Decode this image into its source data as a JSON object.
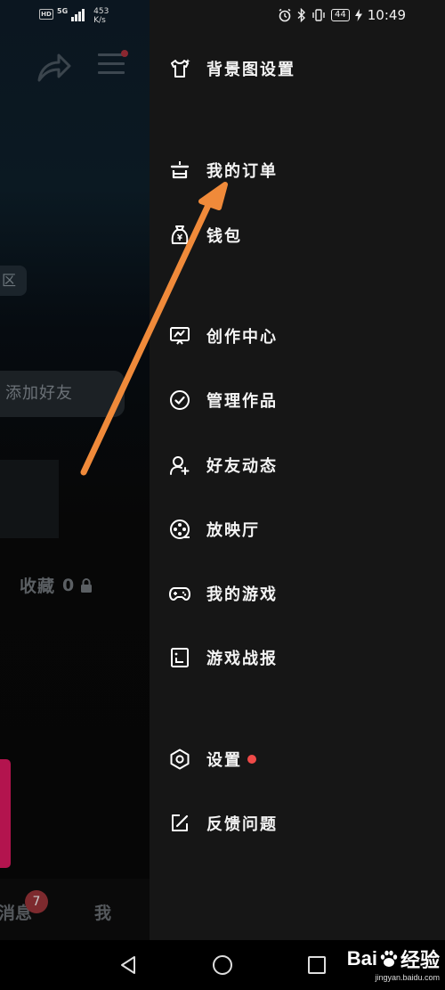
{
  "status_bar": {
    "hd": "HD",
    "network": "5G",
    "speed_value": "453",
    "speed_unit": "K/s",
    "battery": "44",
    "time": "10:49"
  },
  "background_page": {
    "region_text": "区",
    "add_friend": "添加好友",
    "collect_label": "收藏",
    "collect_count": "0",
    "tab_messages": "消息",
    "tab_messages_badge": "7",
    "tab_me": "我"
  },
  "drawer": {
    "items": [
      {
        "label": "背景图设置",
        "icon": "tshirt-sparkle-icon"
      },
      {
        "label": "我的订单",
        "icon": "order-box-icon"
      },
      {
        "label": "钱包",
        "icon": "wallet-bag-icon"
      },
      {
        "label": "创作中心",
        "icon": "creator-screen-icon"
      },
      {
        "label": "管理作品",
        "icon": "check-circle-icon"
      },
      {
        "label": "好友动态",
        "icon": "person-plus-icon"
      },
      {
        "label": "放映厅",
        "icon": "film-reel-icon"
      },
      {
        "label": "我的游戏",
        "icon": "gamepad-icon"
      },
      {
        "label": "游戏战报",
        "icon": "report-doc-icon"
      },
      {
        "label": "设置",
        "icon": "settings-hexagon-icon",
        "has_dot": true
      },
      {
        "label": "反馈问题",
        "icon": "feedback-edit-icon"
      }
    ]
  },
  "watermark": {
    "brand": "Bai",
    "brand_suffix": "经验",
    "url": "jingyan.baidu.com"
  },
  "colors": {
    "drawer_bg": "#161616",
    "accent_arrow": "#f08a3a",
    "badge_dot": "#ef4a48"
  }
}
